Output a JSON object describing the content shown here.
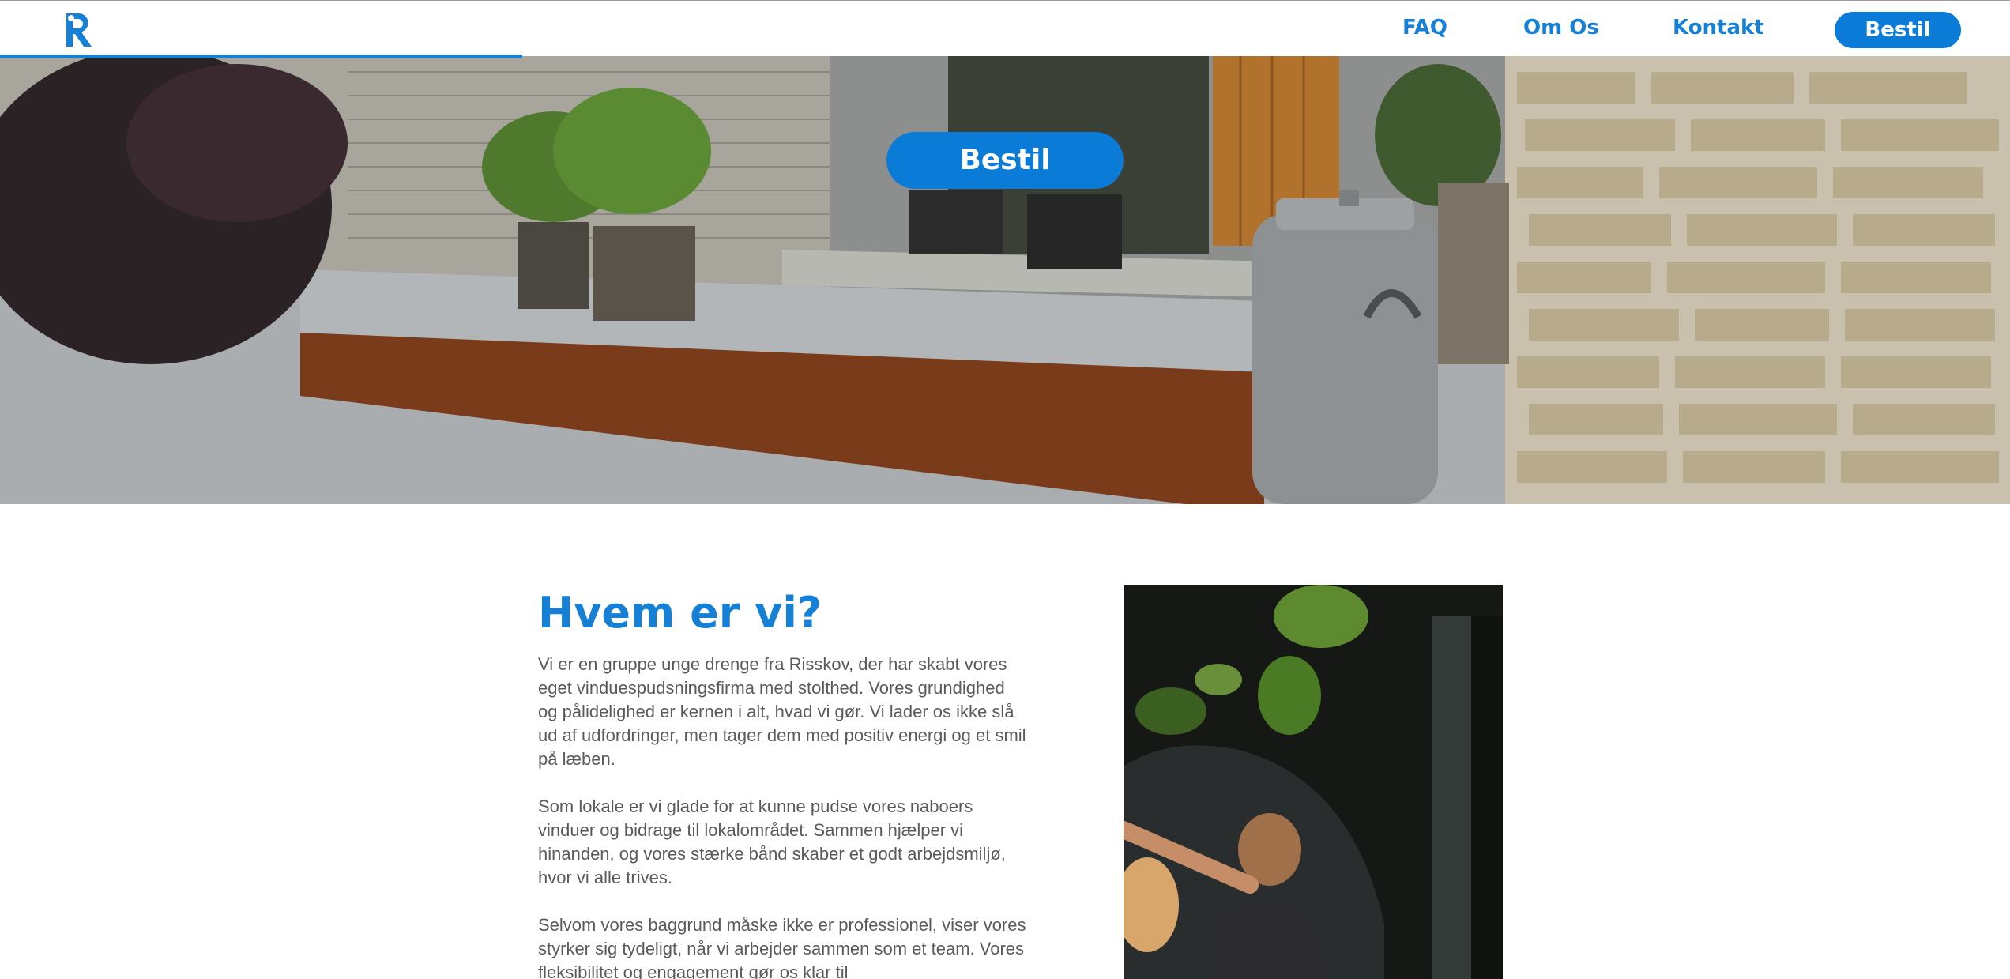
{
  "header": {
    "logo_alt": "R",
    "nav": {
      "faq": "FAQ",
      "about": "Om Os",
      "contact": "Kontakt",
      "order": "Bestil"
    },
    "scroll_progress": 0.26
  },
  "hero": {
    "button_label": "Bestil"
  },
  "about": {
    "title": "Hvem er vi?",
    "paragraphs": [
      "Vi er en gruppe unge drenge fra Risskov, der har skabt vores eget vinduespudsningsfirma med stolthed. Vores grundighed og pålidelighed er kernen i alt, hvad vi gør. Vi lader os ikke slå ud af udfordringer, men tager dem med positiv energi og et smil på læben.",
      "Som lokale er vi glade for at kunne pudse vores naboers vinduer og bidrage til lokalområdet. Sammen hjælper vi hinanden, og vores stærke bånd skaber et godt arbejdsmiljø, hvor vi alle trives.",
      "Selvom vores baggrund måske ikke er professionel, viser vores styrker sig tydeligt, når vi arbejder sammen som et team. Vores fleksibilitet og engagement gør os klar til"
    ]
  },
  "colors": {
    "brand_blue": "#0a7bd6",
    "heading_blue": "#1580d6",
    "body_text": "#5a5a5a"
  },
  "icons": {
    "logo": "r-logo-icon"
  }
}
